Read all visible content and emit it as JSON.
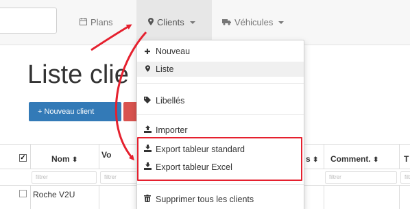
{
  "navbar": {
    "plans_label": "Plans",
    "clients_label": "Clients",
    "vehicles_label": "Véhicules"
  },
  "page": {
    "title": "Liste clie",
    "new_client_button": "Nouveau client"
  },
  "table": {
    "headers": {
      "name": "Nom",
      "voiture": "Vo",
      "col_s": "s",
      "comment": "Comment.",
      "last": "T"
    },
    "filter_placeholder": "filtrer",
    "rows": [
      {
        "name": "Roche V2U"
      }
    ]
  },
  "dropdown": {
    "items": [
      {
        "label": "Nouveau",
        "icon": "plus-icon"
      },
      {
        "label": "Liste",
        "icon": "map-marker-icon"
      },
      {
        "label": "Libellés",
        "icon": "tags-icon"
      },
      {
        "label": "Importer",
        "icon": "upload-icon"
      },
      {
        "label": "Export tableur standard",
        "icon": "download-icon"
      },
      {
        "label": "Export tableur Excel",
        "icon": "download-icon"
      },
      {
        "label": "Supprimer tous les clients",
        "icon": "trash-icon"
      }
    ]
  },
  "colors": {
    "primary": "#337ab7",
    "danger": "#d9534f",
    "annotation_red": "#e5202e"
  }
}
